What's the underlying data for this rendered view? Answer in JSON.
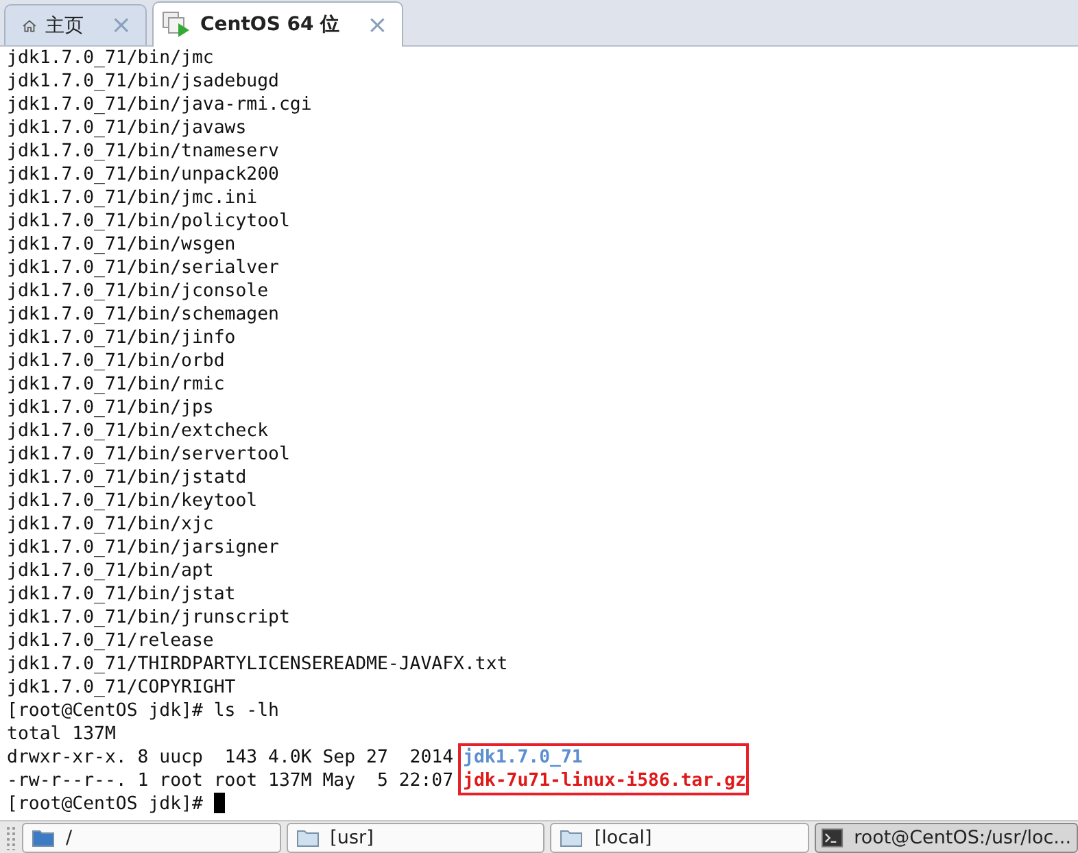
{
  "tabs": [
    {
      "label": "主页",
      "kind": "home",
      "selected": false,
      "close": "×"
    },
    {
      "label": "CentOS 64 位",
      "kind": "vm",
      "selected": true,
      "close": "×"
    }
  ],
  "terminal": {
    "lines": [
      "jdk1.7.0_71/bin/jmc",
      "jdk1.7.0_71/bin/jsadebugd",
      "jdk1.7.0_71/bin/java-rmi.cgi",
      "jdk1.7.0_71/bin/javaws",
      "jdk1.7.0_71/bin/tnameserv",
      "jdk1.7.0_71/bin/unpack200",
      "jdk1.7.0_71/bin/jmc.ini",
      "jdk1.7.0_71/bin/policytool",
      "jdk1.7.0_71/bin/wsgen",
      "jdk1.7.0_71/bin/serialver",
      "jdk1.7.0_71/bin/jconsole",
      "jdk1.7.0_71/bin/schemagen",
      "jdk1.7.0_71/bin/jinfo",
      "jdk1.7.0_71/bin/orbd",
      "jdk1.7.0_71/bin/rmic",
      "jdk1.7.0_71/bin/jps",
      "jdk1.7.0_71/bin/extcheck",
      "jdk1.7.0_71/bin/servertool",
      "jdk1.7.0_71/bin/jstatd",
      "jdk1.7.0_71/bin/keytool",
      "jdk1.7.0_71/bin/xjc",
      "jdk1.7.0_71/bin/jarsigner",
      "jdk1.7.0_71/bin/apt",
      "jdk1.7.0_71/bin/jstat",
      "jdk1.7.0_71/bin/jrunscript",
      "jdk1.7.0_71/release",
      "jdk1.7.0_71/THIRDPARTYLICENSEREADME-JAVAFX.txt",
      "jdk1.7.0_71/COPYRIGHT",
      "[root@CentOS jdk]# ls -lh",
      "total 137M"
    ],
    "listing": {
      "highlighted": true,
      "entries": [
        {
          "info": "drwxr-xr-x. 8 uucp  143 4.0K Sep 27  2014",
          "name": "jdk1.7.0_71",
          "kind": "dir"
        },
        {
          "info": "-rw-r--r--. 1 root root 137M May  5 22:07",
          "name": "jdk-7u71-linux-i586.tar.gz",
          "kind": "archive"
        }
      ]
    },
    "prompt": {
      "text": "[root@CentOS jdk]# ",
      "cursor": true
    }
  },
  "taskbar": [
    {
      "label": "/",
      "kind": "root-folder",
      "selected": false
    },
    {
      "label": "[usr]",
      "kind": "folder",
      "selected": false
    },
    {
      "label": "[local]",
      "kind": "folder",
      "selected": false
    },
    {
      "label": "root@CentOS:/usr/loc...",
      "kind": "terminal",
      "selected": true
    }
  ]
}
